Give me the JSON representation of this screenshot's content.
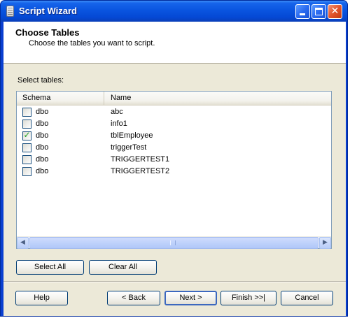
{
  "window": {
    "title": "Script Wizard"
  },
  "header": {
    "title": "Choose Tables",
    "subtitle": "Choose the tables you want to script."
  },
  "select_label": "Select tables:",
  "table": {
    "columns": [
      "Schema",
      "Name"
    ],
    "rows": [
      {
        "checked": false,
        "schema": "dbo",
        "name": "abc"
      },
      {
        "checked": false,
        "schema": "dbo",
        "name": "info1"
      },
      {
        "checked": true,
        "schema": "dbo",
        "name": "tblEmployee"
      },
      {
        "checked": false,
        "schema": "dbo",
        "name": "triggerTest"
      },
      {
        "checked": false,
        "schema": "dbo",
        "name": "TRIGGERTEST1"
      },
      {
        "checked": false,
        "schema": "dbo",
        "name": "TRIGGERTEST2"
      }
    ]
  },
  "buttons": {
    "select_all": "Select All",
    "clear_all": "Clear All",
    "help": "Help",
    "back": "< Back",
    "next": "Next >",
    "finish": "Finish >>|",
    "cancel": "Cancel"
  },
  "icons": {
    "window": "script-icon",
    "minimize": "minimize-icon",
    "maximize": "maximize-icon",
    "close": "close-icon",
    "scroll_left": "arrow-left-icon",
    "scroll_right": "arrow-right-icon"
  },
  "colors": {
    "titlebar": "#0a55e0",
    "dialog_bg": "#ece9d8",
    "check": "#21a121"
  }
}
